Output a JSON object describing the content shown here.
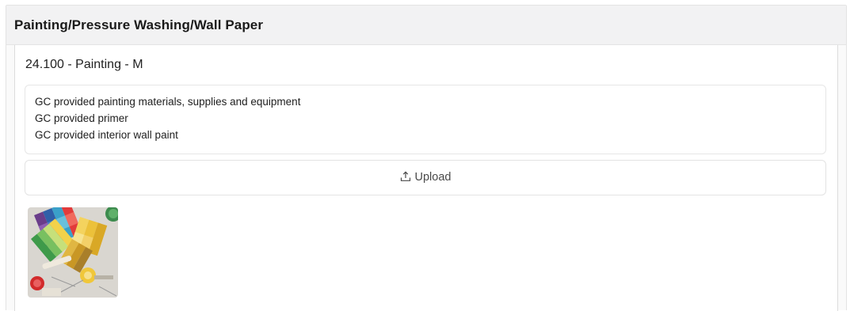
{
  "section": {
    "title": "Painting/Pressure Washing/Wall Paper"
  },
  "item": {
    "title": "24.100 - Painting - M",
    "notes": [
      "GC provided painting materials, supplies and equipment",
      "GC provided primer",
      "GC provided interior wall paint"
    ],
    "upload_label": "Upload",
    "upload_icon": "upload-icon",
    "photo_icon": "paint-swatches-photo"
  },
  "colors": {
    "header_bg": "#f2f2f3",
    "card_border": "#e6e6e6",
    "text": "#1e1e1e"
  }
}
